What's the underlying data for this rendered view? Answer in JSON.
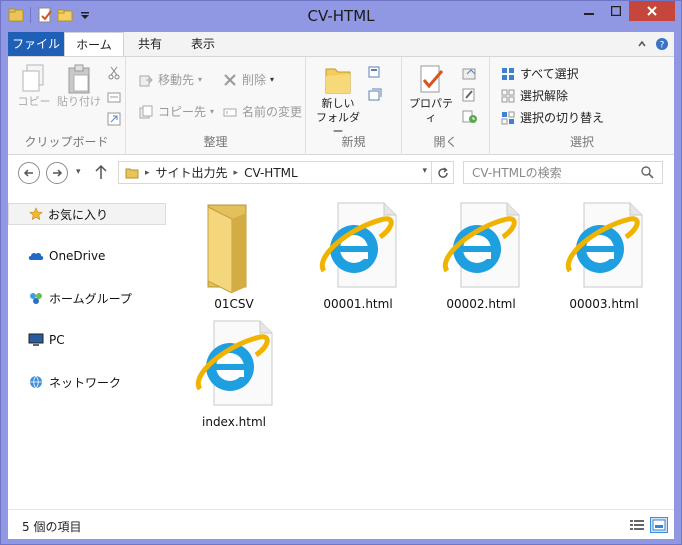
{
  "window": {
    "title": "CV-HTML"
  },
  "ribbon_tabs": {
    "file": "ファイル",
    "home": "ホーム",
    "share": "共有",
    "view": "表示"
  },
  "ribbon": {
    "clipboard": {
      "copy": "コピー",
      "paste": "貼り付け",
      "group": "クリップボード"
    },
    "organize": {
      "move_to": "移動先",
      "copy_to": "コピー先",
      "delete": "削除",
      "rename": "名前の変更",
      "group": "整理"
    },
    "new": {
      "new_folder_line1": "新しい",
      "new_folder_line2": "フォルダー",
      "group": "新規"
    },
    "open": {
      "properties": "プロパティ",
      "group": "開く"
    },
    "select": {
      "select_all": "すべて選択",
      "select_none": "選択解除",
      "invert": "選択の切り替え",
      "group": "選択"
    }
  },
  "address": {
    "crumb1": "サイト出力先",
    "crumb2": "CV-HTML"
  },
  "search": {
    "placeholder": "CV-HTMLの検索"
  },
  "nav": {
    "favorites": "お気に入り",
    "onedrive": "OneDrive",
    "homegroup": "ホームグループ",
    "pc": "PC",
    "network": "ネットワーク"
  },
  "files": [
    {
      "name": "01CSV",
      "icon": "folder-icon"
    },
    {
      "name": "00001.html",
      "icon": "ie-html-file-icon"
    },
    {
      "name": "00002.html",
      "icon": "ie-html-file-icon"
    },
    {
      "name": "00003.html",
      "icon": "ie-html-file-icon"
    },
    {
      "name": "index.html",
      "icon": "ie-html-file-icon"
    }
  ],
  "status": {
    "item_count": "5 個の項目"
  },
  "colors": {
    "title_bar": "#9097e3",
    "file_tab": "#1f5fb5",
    "close_button": "#c7463b",
    "ie_blue": "#1e9fe0",
    "ie_ring": "#f0b400"
  }
}
